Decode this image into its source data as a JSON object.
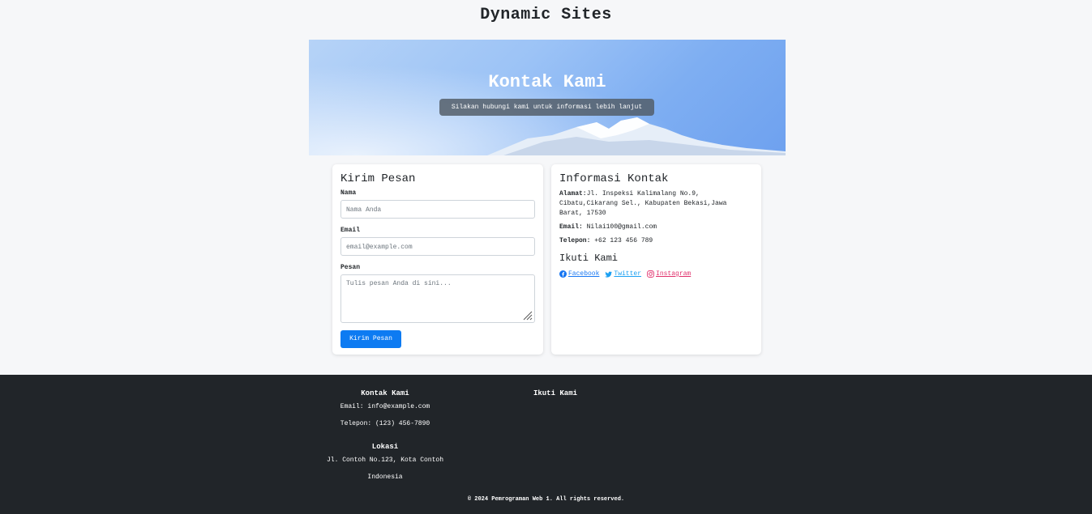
{
  "site": {
    "title": "Dynamic Sites"
  },
  "hero": {
    "title": "Kontak Kami",
    "subtitle": "Silakan hubungi kami untuk informasi lebih lanjut"
  },
  "form": {
    "heading": "Kirim Pesan",
    "name_label": "Nama",
    "name_placeholder": "Nama Anda",
    "email_label": "Email",
    "email_placeholder": "email@example.com",
    "message_label": "Pesan",
    "message_placeholder": "Tulis pesan Anda di sini...",
    "submit_label": "Kirim Pesan"
  },
  "contact_info": {
    "heading": "Informasi Kontak",
    "address_label": "Alamat:",
    "address_value": "Jl. Inspeksi Kalimalang No.9, Cibatu,Cikarang Sel., Kabupaten Bekasi,Jawa Barat, 17530",
    "email_label": "Email:",
    "email_value": "Nilai100@gmail.com",
    "phone_label": "Telepon:",
    "phone_value": "+62 123 456 789",
    "follow_heading": "Ikuti Kami",
    "social": {
      "facebook": " Facebook",
      "twitter": " Twitter",
      "instagram": " Instagram"
    }
  },
  "footer": {
    "contact_heading": "Kontak Kami",
    "contact_email": "Email: info@example.com",
    "contact_phone": "Telepon: (123) 456-7890",
    "location_heading": "Lokasi",
    "location_address": "Jl. Contoh No.123, Kota Contoh",
    "location_country": "Indonesia",
    "follow_heading": "Ikuti Kami",
    "copyright": "© 2024 Pemrograman Web 1. All rights reserved."
  },
  "colors": {
    "primary_button": "#0d7bf2",
    "footer_bg": "#212529",
    "facebook": "#1877f2",
    "twitter": "#1da1f2",
    "instagram": "#e1306c"
  }
}
